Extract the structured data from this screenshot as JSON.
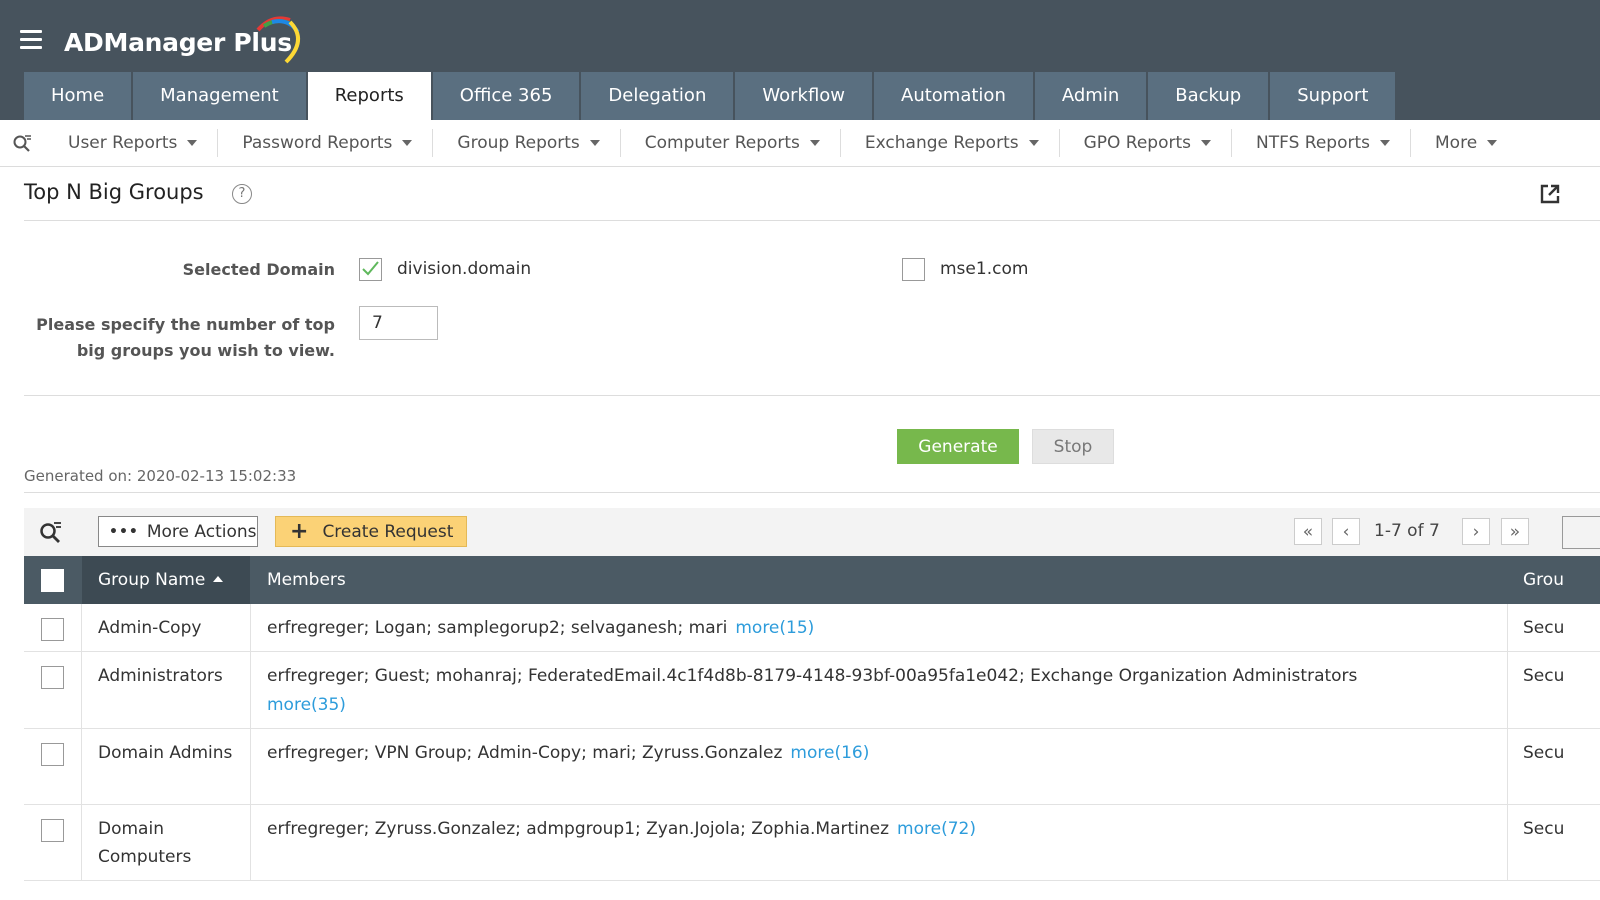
{
  "app": {
    "name": "ADManager Plus"
  },
  "nav": {
    "tabs": [
      {
        "label": "Home"
      },
      {
        "label": "Management"
      },
      {
        "label": "Reports"
      },
      {
        "label": "Office 365"
      },
      {
        "label": "Delegation"
      },
      {
        "label": "Workflow"
      },
      {
        "label": "Automation"
      },
      {
        "label": "Admin"
      },
      {
        "label": "Backup"
      },
      {
        "label": "Support"
      }
    ],
    "active_tab": "Reports"
  },
  "subnav": {
    "items": [
      {
        "label": "User Reports"
      },
      {
        "label": "Password Reports"
      },
      {
        "label": "Group Reports"
      },
      {
        "label": "Computer Reports"
      },
      {
        "label": "Exchange Reports"
      },
      {
        "label": "GPO Reports"
      },
      {
        "label": "NTFS Reports"
      },
      {
        "label": "More"
      }
    ]
  },
  "page": {
    "title": "Top N Big Groups",
    "help": "?"
  },
  "form": {
    "domain_label": "Selected Domain",
    "domains": [
      {
        "name": "division.domain",
        "checked": true
      },
      {
        "name": "mse1.com",
        "checked": false
      }
    ],
    "count_label_line1": "Please specify the number of top",
    "count_label_line2": "big groups you wish to view.",
    "count_value": "7",
    "generate_label": "Generate",
    "stop_label": "Stop",
    "generated_on": "Generated on: 2020-02-13 15:02:33"
  },
  "toolbar": {
    "more_actions_label": "More Actions",
    "create_request_label": "Create Request",
    "pagination": "1-7 of 7",
    "first_icon": "«",
    "prev_icon": "‹",
    "next_icon": "›",
    "last_icon": "»"
  },
  "table": {
    "headers": {
      "name": "Group Name",
      "members": "Members",
      "type": "Grou"
    },
    "rows": [
      {
        "name": "Admin-Copy",
        "members": "erfregreger; Logan; samplegorup2; selvaganesh; mari",
        "more": "more(15)",
        "type": "Secu"
      },
      {
        "name": "Administrators",
        "members": "erfregreger; Guest; mohanraj; FederatedEmail.4c1f4d8b-8179-4148-93bf-00a95fa1e042; Exchange Organization Administrators",
        "more": "more(35)",
        "type": "Secu"
      },
      {
        "name": "Domain Admins",
        "members": "erfregreger; VPN Group; Admin-Copy; mari; Zyruss.Gonzalez",
        "more": "more(16)",
        "type": "Secu"
      },
      {
        "name": "Domain Computers",
        "members": "erfregreger; Zyruss.Gonzalez; admpgroup1; Zyan.Jojola; Zophia.Martinez",
        "more": "more(72)",
        "type": "Secu"
      }
    ]
  },
  "colors": {
    "header_bg": "#47535d",
    "tab_bg": "#5a6f80",
    "generate_green": "#77b84c",
    "create_yellow": "#fbd276",
    "link_blue": "#2d9cdb",
    "table_head": "#4b5a64"
  },
  "icons": [
    "hamburger-icon",
    "logo-arc-icon",
    "search-filter-icon",
    "help-icon",
    "export-icon",
    "checkmark-icon",
    "sort-up-icon"
  ]
}
